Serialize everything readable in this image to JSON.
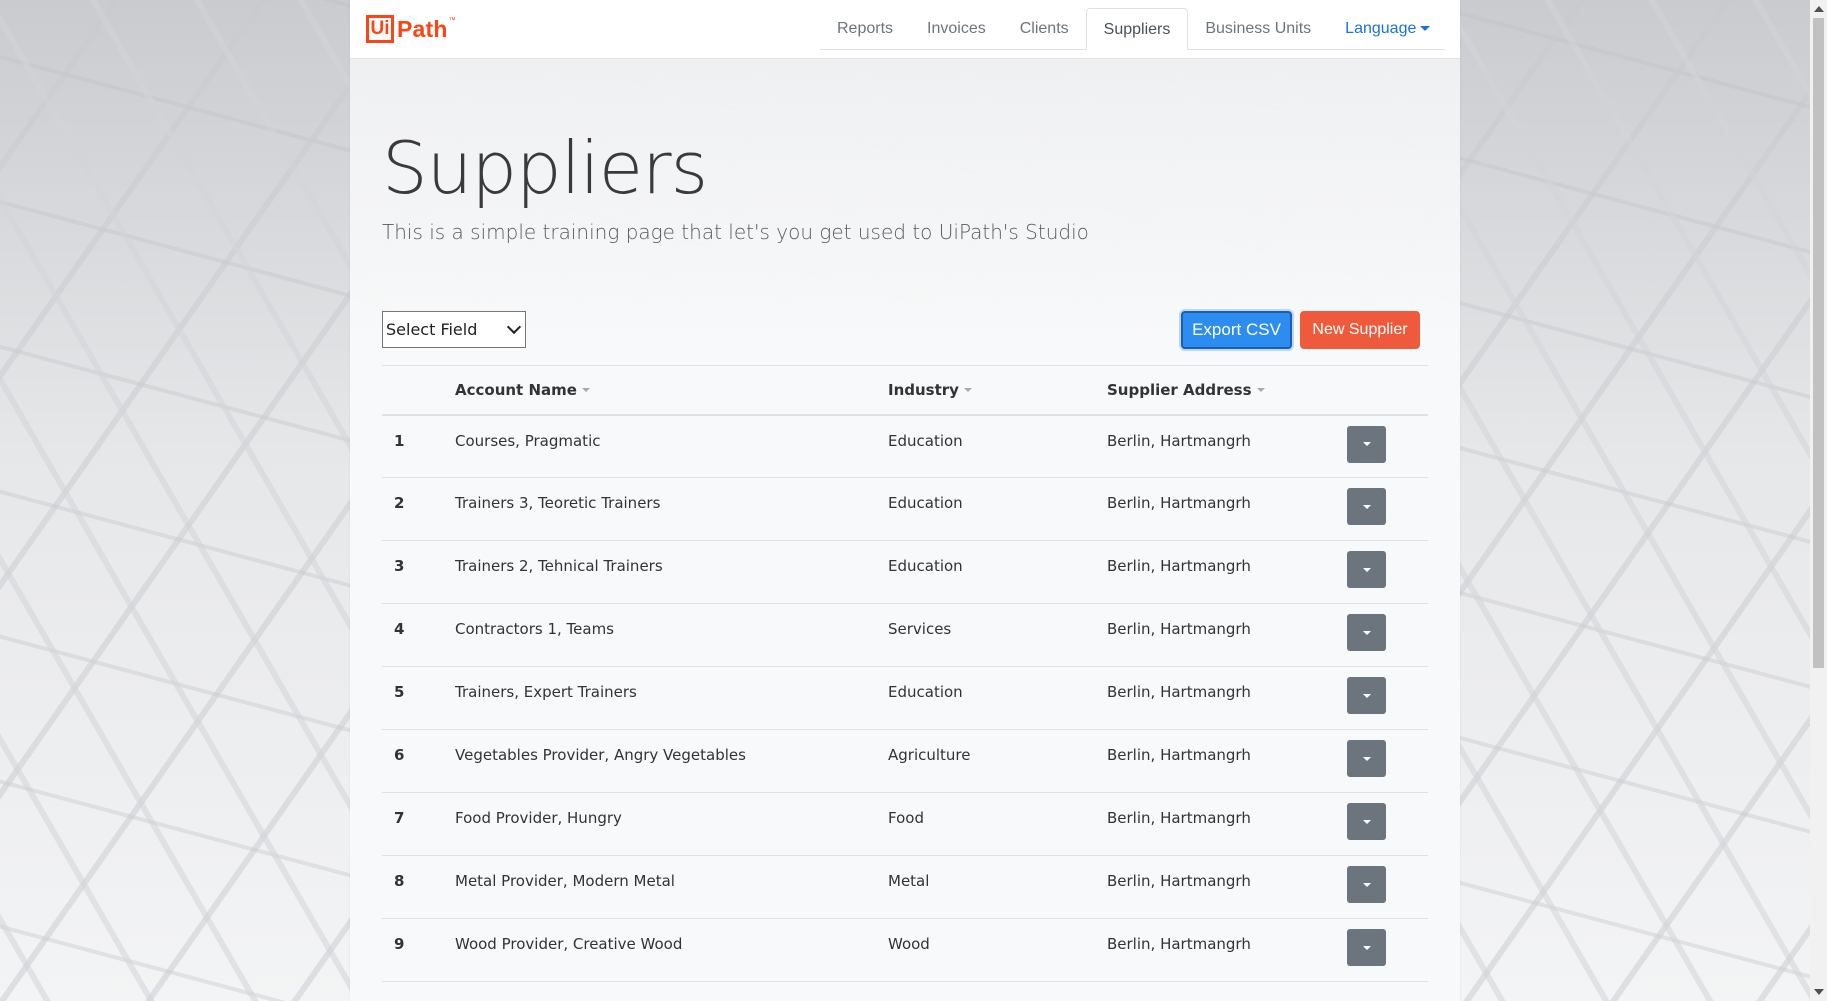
{
  "brand": {
    "logo_box": "Ui",
    "logo_rest": "Path",
    "logo_tm": "™",
    "color": "#fa4616"
  },
  "nav": {
    "items": [
      {
        "label": "Reports"
      },
      {
        "label": "Invoices"
      },
      {
        "label": "Clients"
      },
      {
        "label": "Suppliers",
        "active": true
      },
      {
        "label": "Business Units"
      }
    ],
    "language_label": "Language"
  },
  "page": {
    "title": "Suppliers",
    "subtitle": "This is a simple training page that let's you get used to UiPath's Studio"
  },
  "toolbar": {
    "select_field": "Select Field",
    "export_label": "Export CSV",
    "new_label": "New Supplier"
  },
  "table": {
    "headers": [
      "",
      "Account Name",
      "Industry",
      "Supplier Address",
      ""
    ],
    "rows": [
      {
        "num": "1",
        "name": "Courses, Pragmatic",
        "industry": "Education",
        "address": "Berlin, Hartmangrh"
      },
      {
        "num": "2",
        "name": "Trainers 3, Teoretic Trainers",
        "industry": "Education",
        "address": "Berlin, Hartmangrh"
      },
      {
        "num": "3",
        "name": "Trainers 2, Tehnical Trainers",
        "industry": "Education",
        "address": "Berlin, Hartmangrh"
      },
      {
        "num": "4",
        "name": "Contractors 1, Teams",
        "industry": "Services",
        "address": "Berlin, Hartmangrh"
      },
      {
        "num": "5",
        "name": "Trainers, Expert Trainers",
        "industry": "Education",
        "address": "Berlin, Hartmangrh"
      },
      {
        "num": "6",
        "name": "Vegetables Provider, Angry Vegetables",
        "industry": "Agriculture",
        "address": "Berlin, Hartmangrh"
      },
      {
        "num": "7",
        "name": "Food Provider, Hungry",
        "industry": "Food",
        "address": "Berlin, Hartmangrh"
      },
      {
        "num": "8",
        "name": "Metal Provider, Modern Metal",
        "industry": "Metal",
        "address": "Berlin, Hartmangrh"
      },
      {
        "num": "9",
        "name": "Wood Provider, Creative Wood",
        "industry": "Wood",
        "address": "Berlin, Hartmangrh"
      }
    ]
  }
}
